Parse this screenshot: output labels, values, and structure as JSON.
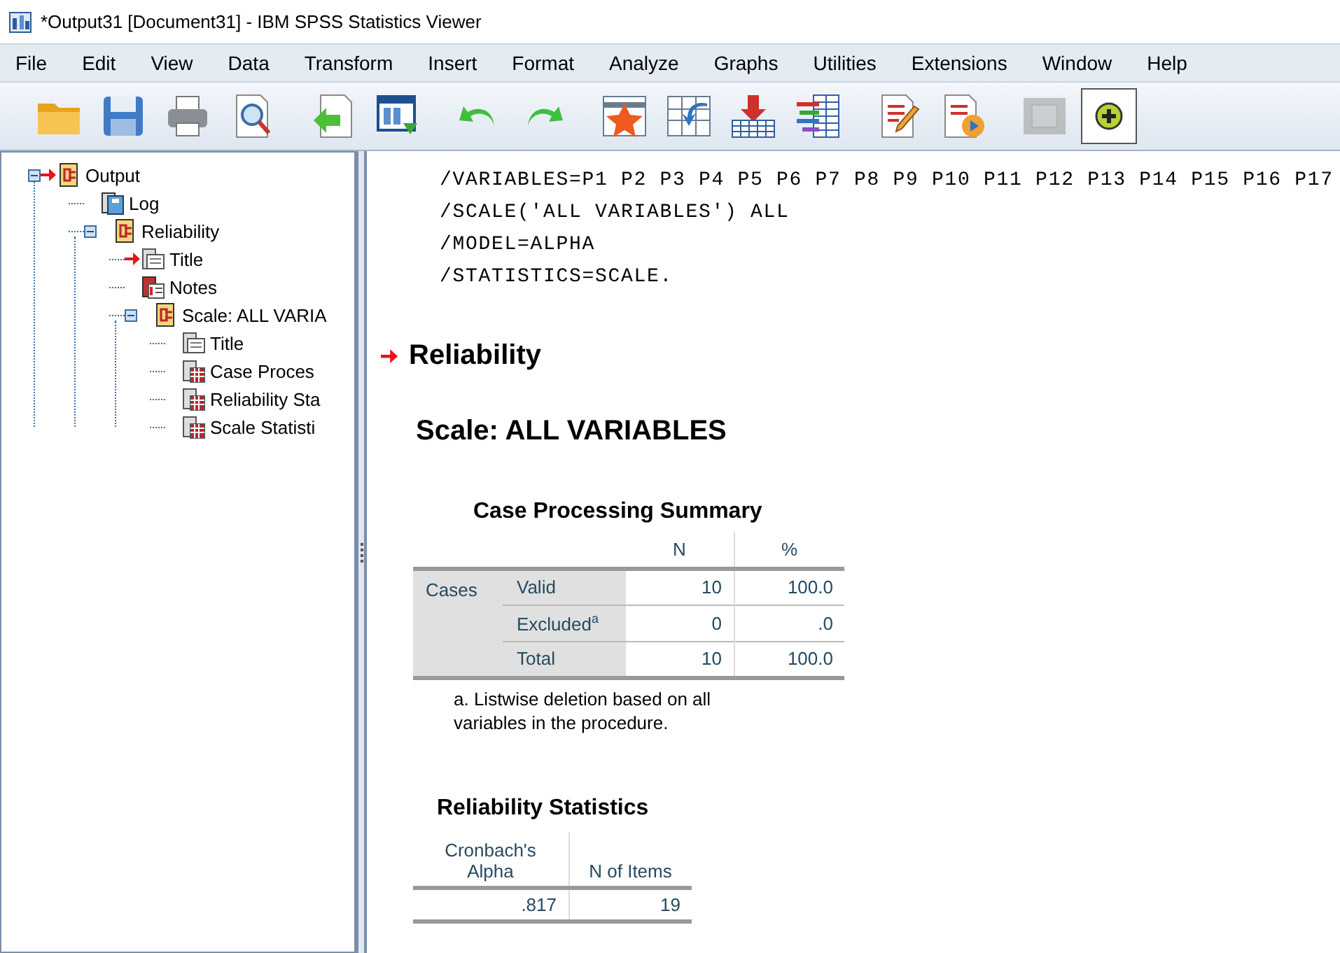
{
  "window": {
    "title": "*Output31 [Document31] - IBM SPSS Statistics Viewer"
  },
  "menu": [
    "File",
    "Edit",
    "View",
    "Data",
    "Transform",
    "Insert",
    "Format",
    "Analyze",
    "Graphs",
    "Utilities",
    "Extensions",
    "Window",
    "Help"
  ],
  "toolbar": [
    {
      "kind": "folder",
      "pressed": false,
      "disabled": false
    },
    {
      "kind": "floppy",
      "pressed": false,
      "disabled": false
    },
    {
      "kind": "printer",
      "pressed": false,
      "disabled": false
    },
    {
      "kind": "page-magnifier",
      "pressed": false,
      "disabled": false
    },
    {
      "kind": "page-arrow",
      "pressed": false,
      "disabled": false
    },
    {
      "kind": "window-arrow",
      "pressed": false,
      "disabled": false
    },
    {
      "kind": "undo",
      "pressed": false,
      "disabled": false
    },
    {
      "kind": "redo",
      "pressed": false,
      "disabled": false
    },
    {
      "kind": "star-grid",
      "pressed": false,
      "disabled": false
    },
    {
      "kind": "grid-blue-arrow",
      "pressed": false,
      "disabled": false
    },
    {
      "kind": "grid-red-arrow",
      "pressed": false,
      "disabled": false
    },
    {
      "kind": "bars-grid",
      "pressed": false,
      "disabled": false
    },
    {
      "kind": "page-pencil",
      "pressed": false,
      "disabled": false
    },
    {
      "kind": "page-play",
      "pressed": false,
      "disabled": false
    },
    {
      "kind": "grey-square",
      "pressed": false,
      "disabled": true
    },
    {
      "kind": "plus-circle",
      "pressed": true,
      "disabled": false
    }
  ],
  "outline": [
    {
      "label": "Output",
      "kind": "heading",
      "marked": true,
      "expanded": true,
      "children": [
        {
          "label": "Log",
          "kind": "log",
          "marked": false
        },
        {
          "label": "Reliability",
          "kind": "heading",
          "marked": false,
          "expanded": true,
          "children": [
            {
              "label": "Title",
              "kind": "title",
              "marked": true
            },
            {
              "label": "Notes",
              "kind": "notes",
              "marked": false
            },
            {
              "label": "Scale: ALL VARIA",
              "kind": "heading",
              "marked": false,
              "expanded": true,
              "children": [
                {
                  "label": "Title",
                  "kind": "title",
                  "marked": false
                },
                {
                  "label": "Case Proces",
                  "kind": "table",
                  "marked": false
                },
                {
                  "label": "Reliability Sta",
                  "kind": "table",
                  "marked": false
                },
                {
                  "label": "Scale Statisti",
                  "kind": "table",
                  "marked": false
                }
              ]
            }
          ]
        }
      ]
    }
  ],
  "output": {
    "syntax": [
      "/VARIABLES=P1 P2 P3 P4 P5 P6 P7 P8 P9 P10 P11 P12 P13 P14 P15 P16 P17",
      "/SCALE('ALL VARIABLES') ALL",
      "/MODEL=ALPHA",
      "/STATISTICS=SCALE."
    ],
    "heading": {
      "text": "Reliability",
      "marked": true
    },
    "subheading": "Scale: ALL VARIABLES",
    "case_summary": {
      "title": "Case Processing Summary",
      "columns": [
        "N",
        "%"
      ],
      "group": "Cases",
      "rows": [
        {
          "label": "Valid",
          "values": [
            "10",
            "100.0"
          ]
        },
        {
          "label": "Excluded$^{a}$",
          "values": [
            "0",
            ".0"
          ]
        },
        {
          "label": "Total",
          "values": [
            "10",
            "100.0"
          ]
        }
      ],
      "footnote": "a. Listwise deletion based on all variables in the procedure."
    },
    "reliability_statistics": {
      "title": "Reliability Statistics",
      "columns": [
        "Cronbach's Alpha",
        "N of Items"
      ],
      "values": [
        ".817",
        "19"
      ]
    }
  }
}
